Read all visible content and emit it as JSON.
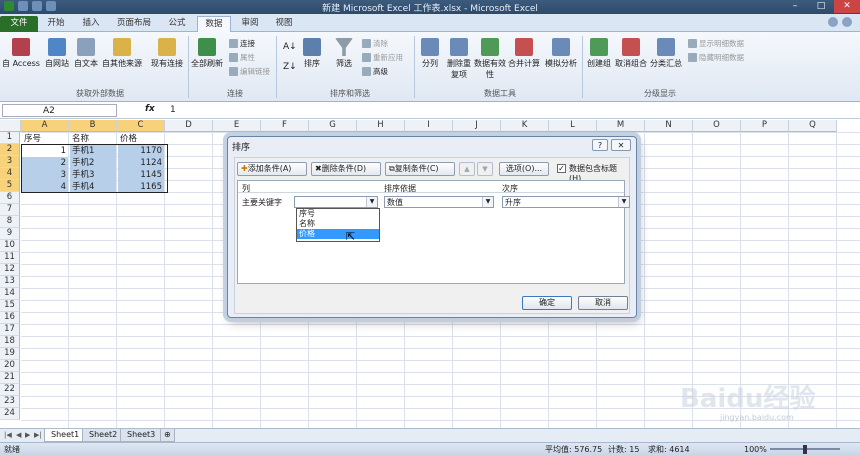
{
  "window": {
    "title": "新建 Microsoft Excel 工作表.xlsx - Microsoft Excel"
  },
  "ribbon_tabs": [
    "文件",
    "开始",
    "插入",
    "页面布局",
    "公式",
    "数据",
    "审阅",
    "视图"
  ],
  "ribbon": {
    "get_external": {
      "access": "自 Access",
      "web": "自网站",
      "text": "自文本",
      "other": "自其他来源",
      "existing": "现有连接",
      "group": "获取外部数据"
    },
    "connections": {
      "refresh": "全部刷新",
      "conn": "连接",
      "props": "属性",
      "edit_links": "编辑链接",
      "group": "连接"
    },
    "sort_filter": {
      "sort": "排序",
      "filter": "筛选",
      "clear": "清除",
      "reapply": "重新应用",
      "advanced": "高级",
      "group": "排序和筛选"
    },
    "data_tools": {
      "text_to_cols": "分列",
      "remove_dup": "删除重复项",
      "validation": "数据有效性",
      "consolidate": "合并计算",
      "what_if": "模拟分析",
      "group": "数据工具"
    },
    "outline": {
      "group_btn": "创建组",
      "ungroup": "取消组合",
      "subtotal": "分类汇总",
      "show_detail": "显示明细数据",
      "hide_detail": "隐藏明细数据",
      "group": "分级显示"
    }
  },
  "formula_bar": {
    "namebox": "A2",
    "fx": "fx",
    "value": "1"
  },
  "columns": [
    "A",
    "B",
    "C",
    "D",
    "E",
    "F",
    "G",
    "H",
    "I",
    "J",
    "K",
    "L",
    "M",
    "N",
    "O",
    "P",
    "Q"
  ],
  "rows": [
    "1",
    "2",
    "3",
    "4",
    "5",
    "6",
    "7",
    "8",
    "9",
    "10",
    "11",
    "12",
    "13",
    "14",
    "15",
    "16",
    "17",
    "18",
    "19",
    "20",
    "21",
    "22",
    "23",
    "24"
  ],
  "table": {
    "headers": [
      "序号",
      "名称",
      "价格"
    ],
    "rows": [
      [
        "1",
        "手机1",
        "1170"
      ],
      [
        "2",
        "手机2",
        "1124"
      ],
      [
        "3",
        "手机3",
        "1145"
      ],
      [
        "4",
        "手机4",
        "1165"
      ]
    ]
  },
  "dialog": {
    "title": "排序",
    "help": "?",
    "close": "✕",
    "add_level": "添加条件(A)",
    "delete_level": "删除条件(D)",
    "copy_level": "复制条件(C)",
    "options": "选项(O)...",
    "has_headers": "数据包含标题(H)",
    "col_header": "列",
    "sort_on_header": "排序依据",
    "order_header": "次序",
    "primary_key": "主要关键字",
    "sort_on_value": "数值",
    "order_value": "升序",
    "dropdown_options": [
      "序号",
      "名称",
      "价格"
    ],
    "ok": "确定",
    "cancel": "取消"
  },
  "sheets": [
    "Sheet1",
    "Sheet2",
    "Sheet3"
  ],
  "status": {
    "ready": "就绪",
    "average": "平均值: 576.75",
    "count": "计数: 15",
    "sum": "求和: 4614",
    "zoom": "100%"
  },
  "watermark": {
    "brand": "Baidu经验",
    "url": "jingyan.baidu.com"
  },
  "colors": {
    "file_tab": "#2a6e2a",
    "selection": "#b8cfea",
    "header_sel": "#f8d27a",
    "highlight": "#3399ff"
  }
}
